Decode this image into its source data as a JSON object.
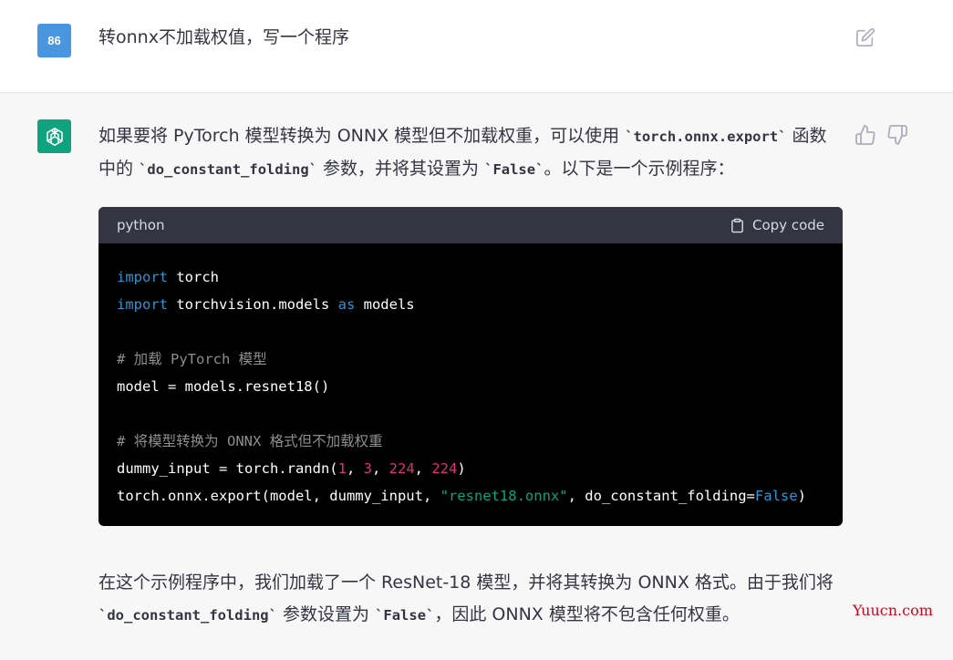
{
  "user": {
    "avatar_text": "86",
    "message": "转onnx不加载权值，写一个程序"
  },
  "assistant": {
    "para1": {
      "t1": "如果要将 PyTorch 模型转换为 ONNX 模型但不加载权重，可以使用 ",
      "c1": "`torch.onnx.export`",
      "t2": " 函数中的 ",
      "c2": "`do_constant_folding`",
      "t3": " 参数，并将其设置为 ",
      "c3": "`False`",
      "t4": "。以下是一个示例程序："
    },
    "code": {
      "language": "python",
      "copy_label": "Copy code",
      "line1_kw": "import",
      "line1_rest": " torch",
      "line2_kw": "import",
      "line2_mid": " torchvision.models ",
      "line2_as": "as",
      "line2_rest": " models",
      "line4_comment": "# 加载 PyTorch 模型",
      "line5": "model = models.resnet18()",
      "line7_comment": "# 将模型转换为 ONNX 格式但不加载权重",
      "line8_a": "dummy_input = torch.randn(",
      "line8_n1": "1",
      "line8_sep1": ", ",
      "line8_n2": "3",
      "line8_sep2": ", ",
      "line8_n3": "224",
      "line8_sep3": ", ",
      "line8_n4": "224",
      "line8_close": ")",
      "line9_a": "torch.onnx.export(model, dummy_input, ",
      "line9_str": "\"resnet18.onnx\"",
      "line9_b": ", do_constant_folding=",
      "line9_bool": "False",
      "line9_close": ")"
    },
    "para2": {
      "t1": "在这个示例程序中，我们加载了一个 ResNet-18 模型，并将其转换为 ONNX 格式。由于我们将 ",
      "c1": "`do_constant_folding`",
      "t2": " 参数设置为 ",
      "c2": "`False`",
      "t3": "，因此 ONNX 模型将不包含任何权重。"
    }
  },
  "watermark": "Yuucn.com",
  "colors": {
    "user_avatar": "#4a95e0",
    "gpt_avatar": "#10a37f",
    "code_bg": "#000000",
    "code_header_bg": "#343541",
    "keyword": "#2e95d3",
    "number": "#df3079",
    "string": "#00a67d",
    "comment": "#8e8e8e"
  },
  "icons": [
    "edit-icon",
    "openai-logo-icon",
    "thumbs-up-icon",
    "thumbs-down-icon",
    "clipboard-icon"
  ]
}
